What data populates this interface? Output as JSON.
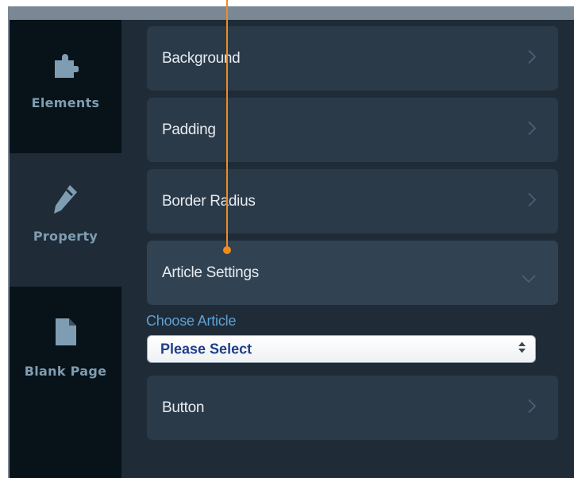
{
  "sidebar": {
    "items": [
      {
        "label": "Elements",
        "icon": "puzzle-icon",
        "active": false
      },
      {
        "label": "Property",
        "icon": "pencil-icon",
        "active": true
      },
      {
        "label": "Blank Page",
        "icon": "page-icon",
        "active": false
      }
    ]
  },
  "properties": {
    "rows": [
      {
        "label": "Background",
        "state": "collapsed"
      },
      {
        "label": "Padding",
        "state": "collapsed"
      },
      {
        "label": "Border Radius",
        "state": "collapsed"
      },
      {
        "label": "Article Settings",
        "state": "expanded"
      },
      {
        "label": "Button",
        "state": "collapsed"
      }
    ],
    "article_settings": {
      "field_label": "Choose Article",
      "select_value": "Please Select"
    }
  },
  "colors": {
    "accent": "#5fa1d2",
    "pointer": "#f08b1e",
    "panel": "#1f2c38",
    "sidebar": "#081219"
  }
}
